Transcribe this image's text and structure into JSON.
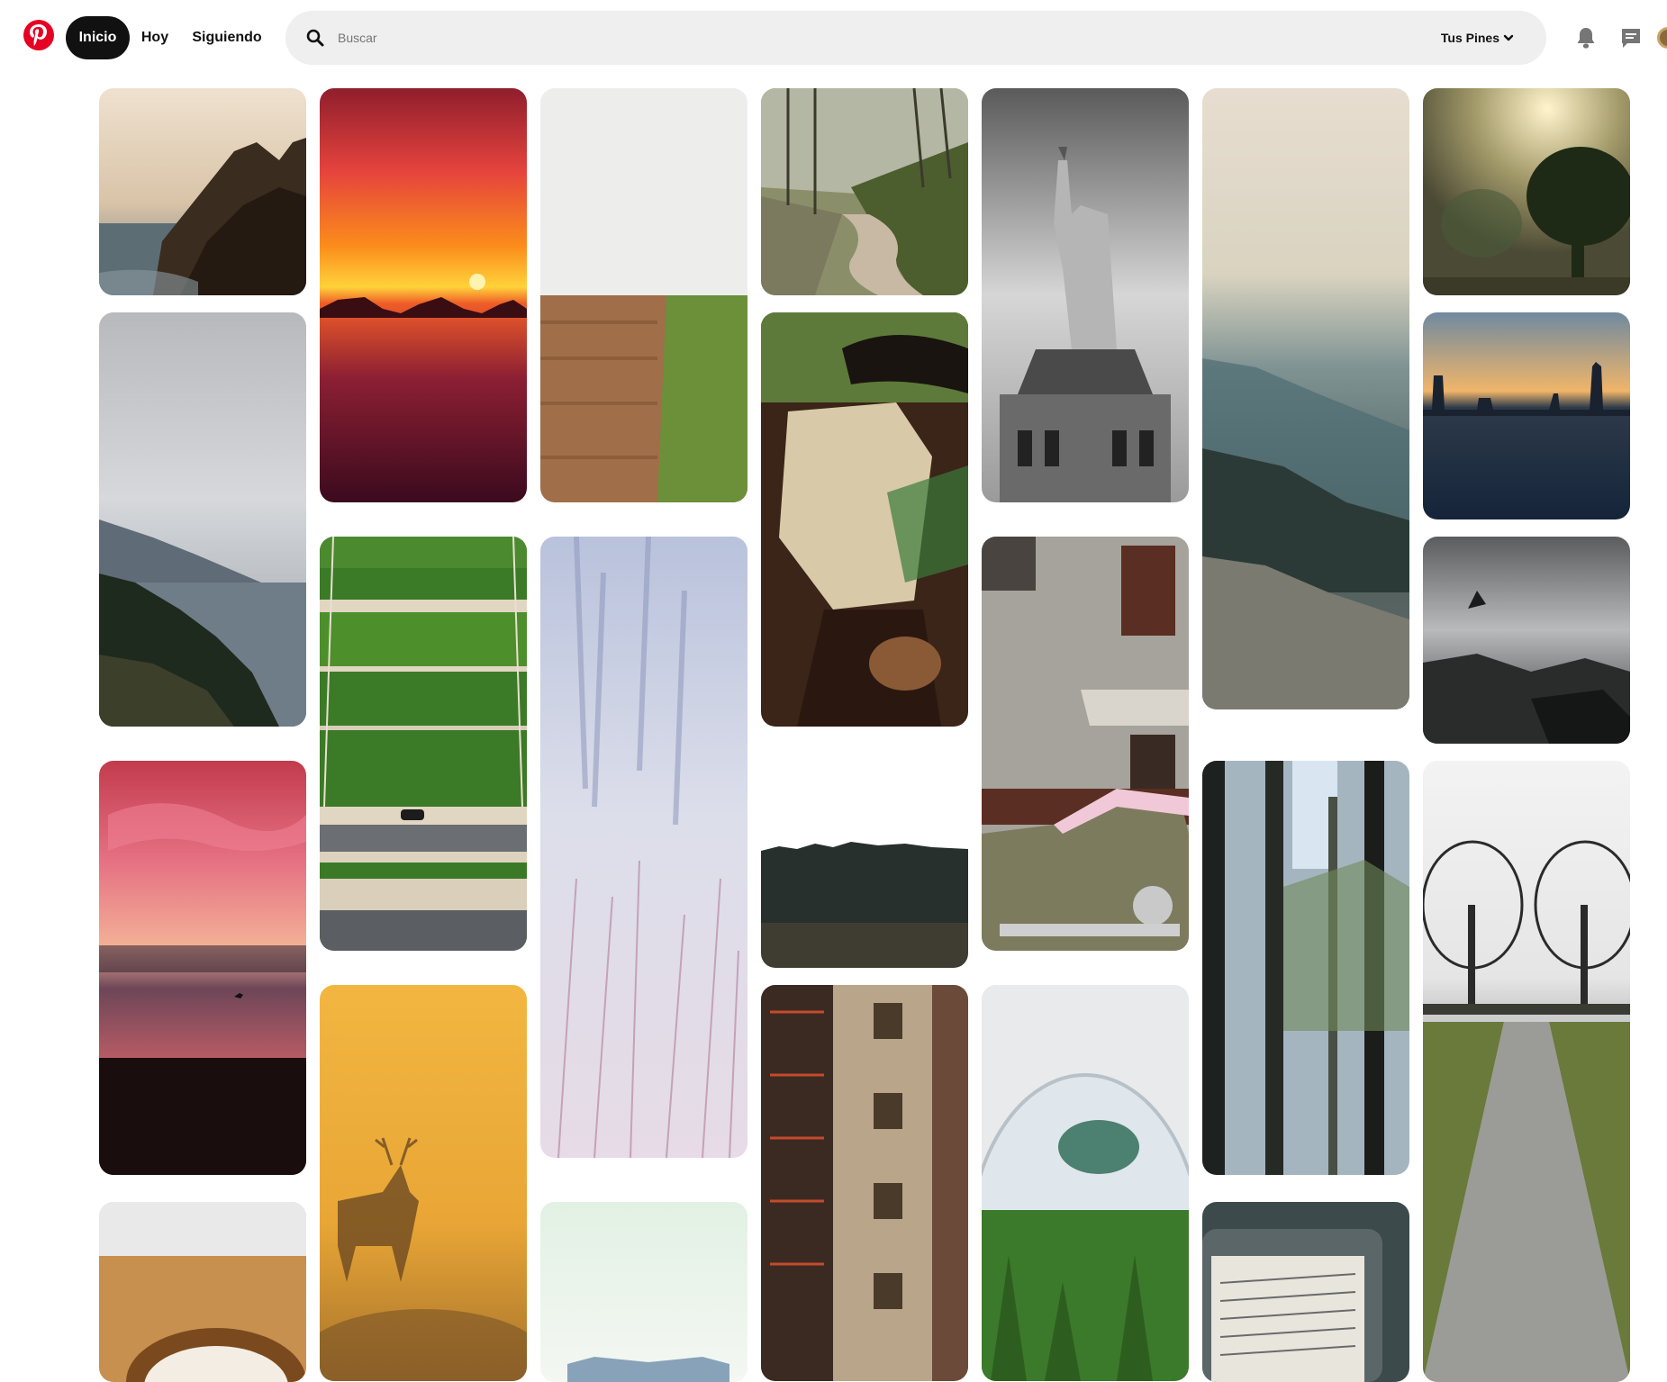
{
  "header": {
    "nav": {
      "inicio": "Inicio",
      "hoy": "Hoy",
      "siguiendo": "Siguiendo"
    },
    "search": {
      "placeholder": "Buscar"
    },
    "tus_pines": "Tus Pines",
    "icons": {
      "logo": "pinterest-logo",
      "search": "search-icon",
      "notifications": "bell-icon",
      "messages": "chat-icon",
      "dropdown": "chevron-down-icon"
    },
    "brand_color": "#e60023"
  },
  "pins": [
    {
      "name": "pin-coastal-cliffs",
      "subject": "sea cliffs at sunset"
    },
    {
      "name": "pin-ocean-sunset",
      "subject": "orange sunset over the sea"
    },
    {
      "name": "pin-plowed-field",
      "subject": "plowed field beside green grass"
    },
    {
      "name": "pin-forest-road",
      "subject": "dirt road through a forest"
    },
    {
      "name": "pin-statue-of-liberty",
      "subject": "black and white Statue of Liberty"
    },
    {
      "name": "pin-valley-overlook",
      "subject": "misty valley seen from a rock"
    },
    {
      "name": "pin-foggy-tree",
      "subject": "tree in foggy sunlight"
    },
    {
      "name": "pin-mountain-coast",
      "subject": "mountains along the coast"
    },
    {
      "name": "pin-soccer-field",
      "subject": "aerial view of grass fields and a car"
    },
    {
      "name": "pin-man-in-hat",
      "subject": "man in a hat leaning on a car"
    },
    {
      "name": "pin-city-skyline",
      "subject": "city skyline over water"
    },
    {
      "name": "pin-frosty-grass",
      "subject": "frosted grass in winter haze"
    },
    {
      "name": "pin-old-building-car",
      "subject": "old building with a vintage car"
    },
    {
      "name": "pin-rocky-shore",
      "subject": "rocky shoreline"
    },
    {
      "name": "pin-pink-sky-beach",
      "subject": "pink sunset on a beach with a bird"
    },
    {
      "name": "pin-pine-treeline",
      "subject": "dark pine treeline over a field"
    },
    {
      "name": "pin-tall-forest",
      "subject": "tall trees with sunbeams"
    },
    {
      "name": "pin-bare-trees-path",
      "subject": "path between bare trees"
    },
    {
      "name": "pin-deer-in-fog",
      "subject": "deer silhouette in golden fog"
    },
    {
      "name": "pin-brick-building",
      "subject": "brick building with fire escapes"
    },
    {
      "name": "pin-terrarium",
      "subject": "succulent terrarium"
    },
    {
      "name": "pin-coffee-cup",
      "subject": "coffee cup on wooden table"
    },
    {
      "name": "pin-beach-scene",
      "subject": "pale beach scene"
    },
    {
      "name": "pin-kindle",
      "subject": "Kindle e-reader"
    }
  ]
}
